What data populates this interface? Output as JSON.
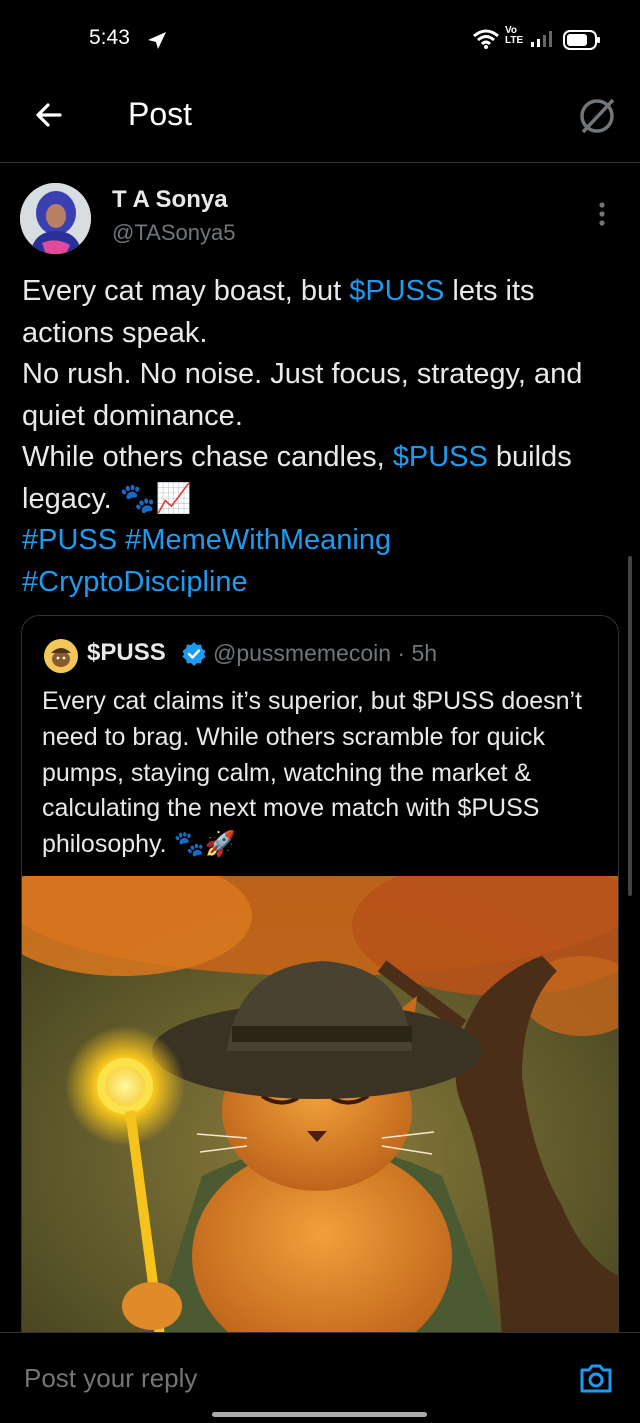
{
  "status_bar": {
    "time": "5:43",
    "volte_top": "Vo",
    "volte_bottom": "LTE"
  },
  "header": {
    "title": "Post"
  },
  "post": {
    "author_name": "T A Sonya",
    "author_handle": "@TASonya5",
    "line1_a": "Every cat may boast, but ",
    "line1_cashtag": "$PUSS",
    "line1_b": " lets its actions speak.",
    "line2": "No rush. No noise. Just focus, strategy, and quiet dominance.",
    "line3_a": "While others chase candles, ",
    "line3_cashtag": "$PUSS",
    "line3_b": " builds legacy. ",
    "line3_emoji": "🐾📈",
    "hashtag1": "#PUSS",
    "hashtag2": "#MemeWithMeaning",
    "hashtag3": "#CryptoDiscipline"
  },
  "quote": {
    "name": "$PUSS",
    "handle": "@pussmemecoin · 5h",
    "text": "Every cat claims it’s superior, but $PUSS doesn’t need to brag. While others scramble for quick pumps, staying calm, watching the market & calculating the next move match with $PUSS philosophy. ",
    "text_emoji": "🐾🚀"
  },
  "reply": {
    "placeholder": "Post your reply"
  },
  "icons": {
    "back": "arrow-left-icon",
    "grok": "grok-icon",
    "more": "more-vertical-icon",
    "verified": "verified-badge-icon",
    "camera": "camera-icon"
  },
  "colors": {
    "link": "#1d9bf0",
    "background": "#000000",
    "secondary_text": "#71767b"
  }
}
